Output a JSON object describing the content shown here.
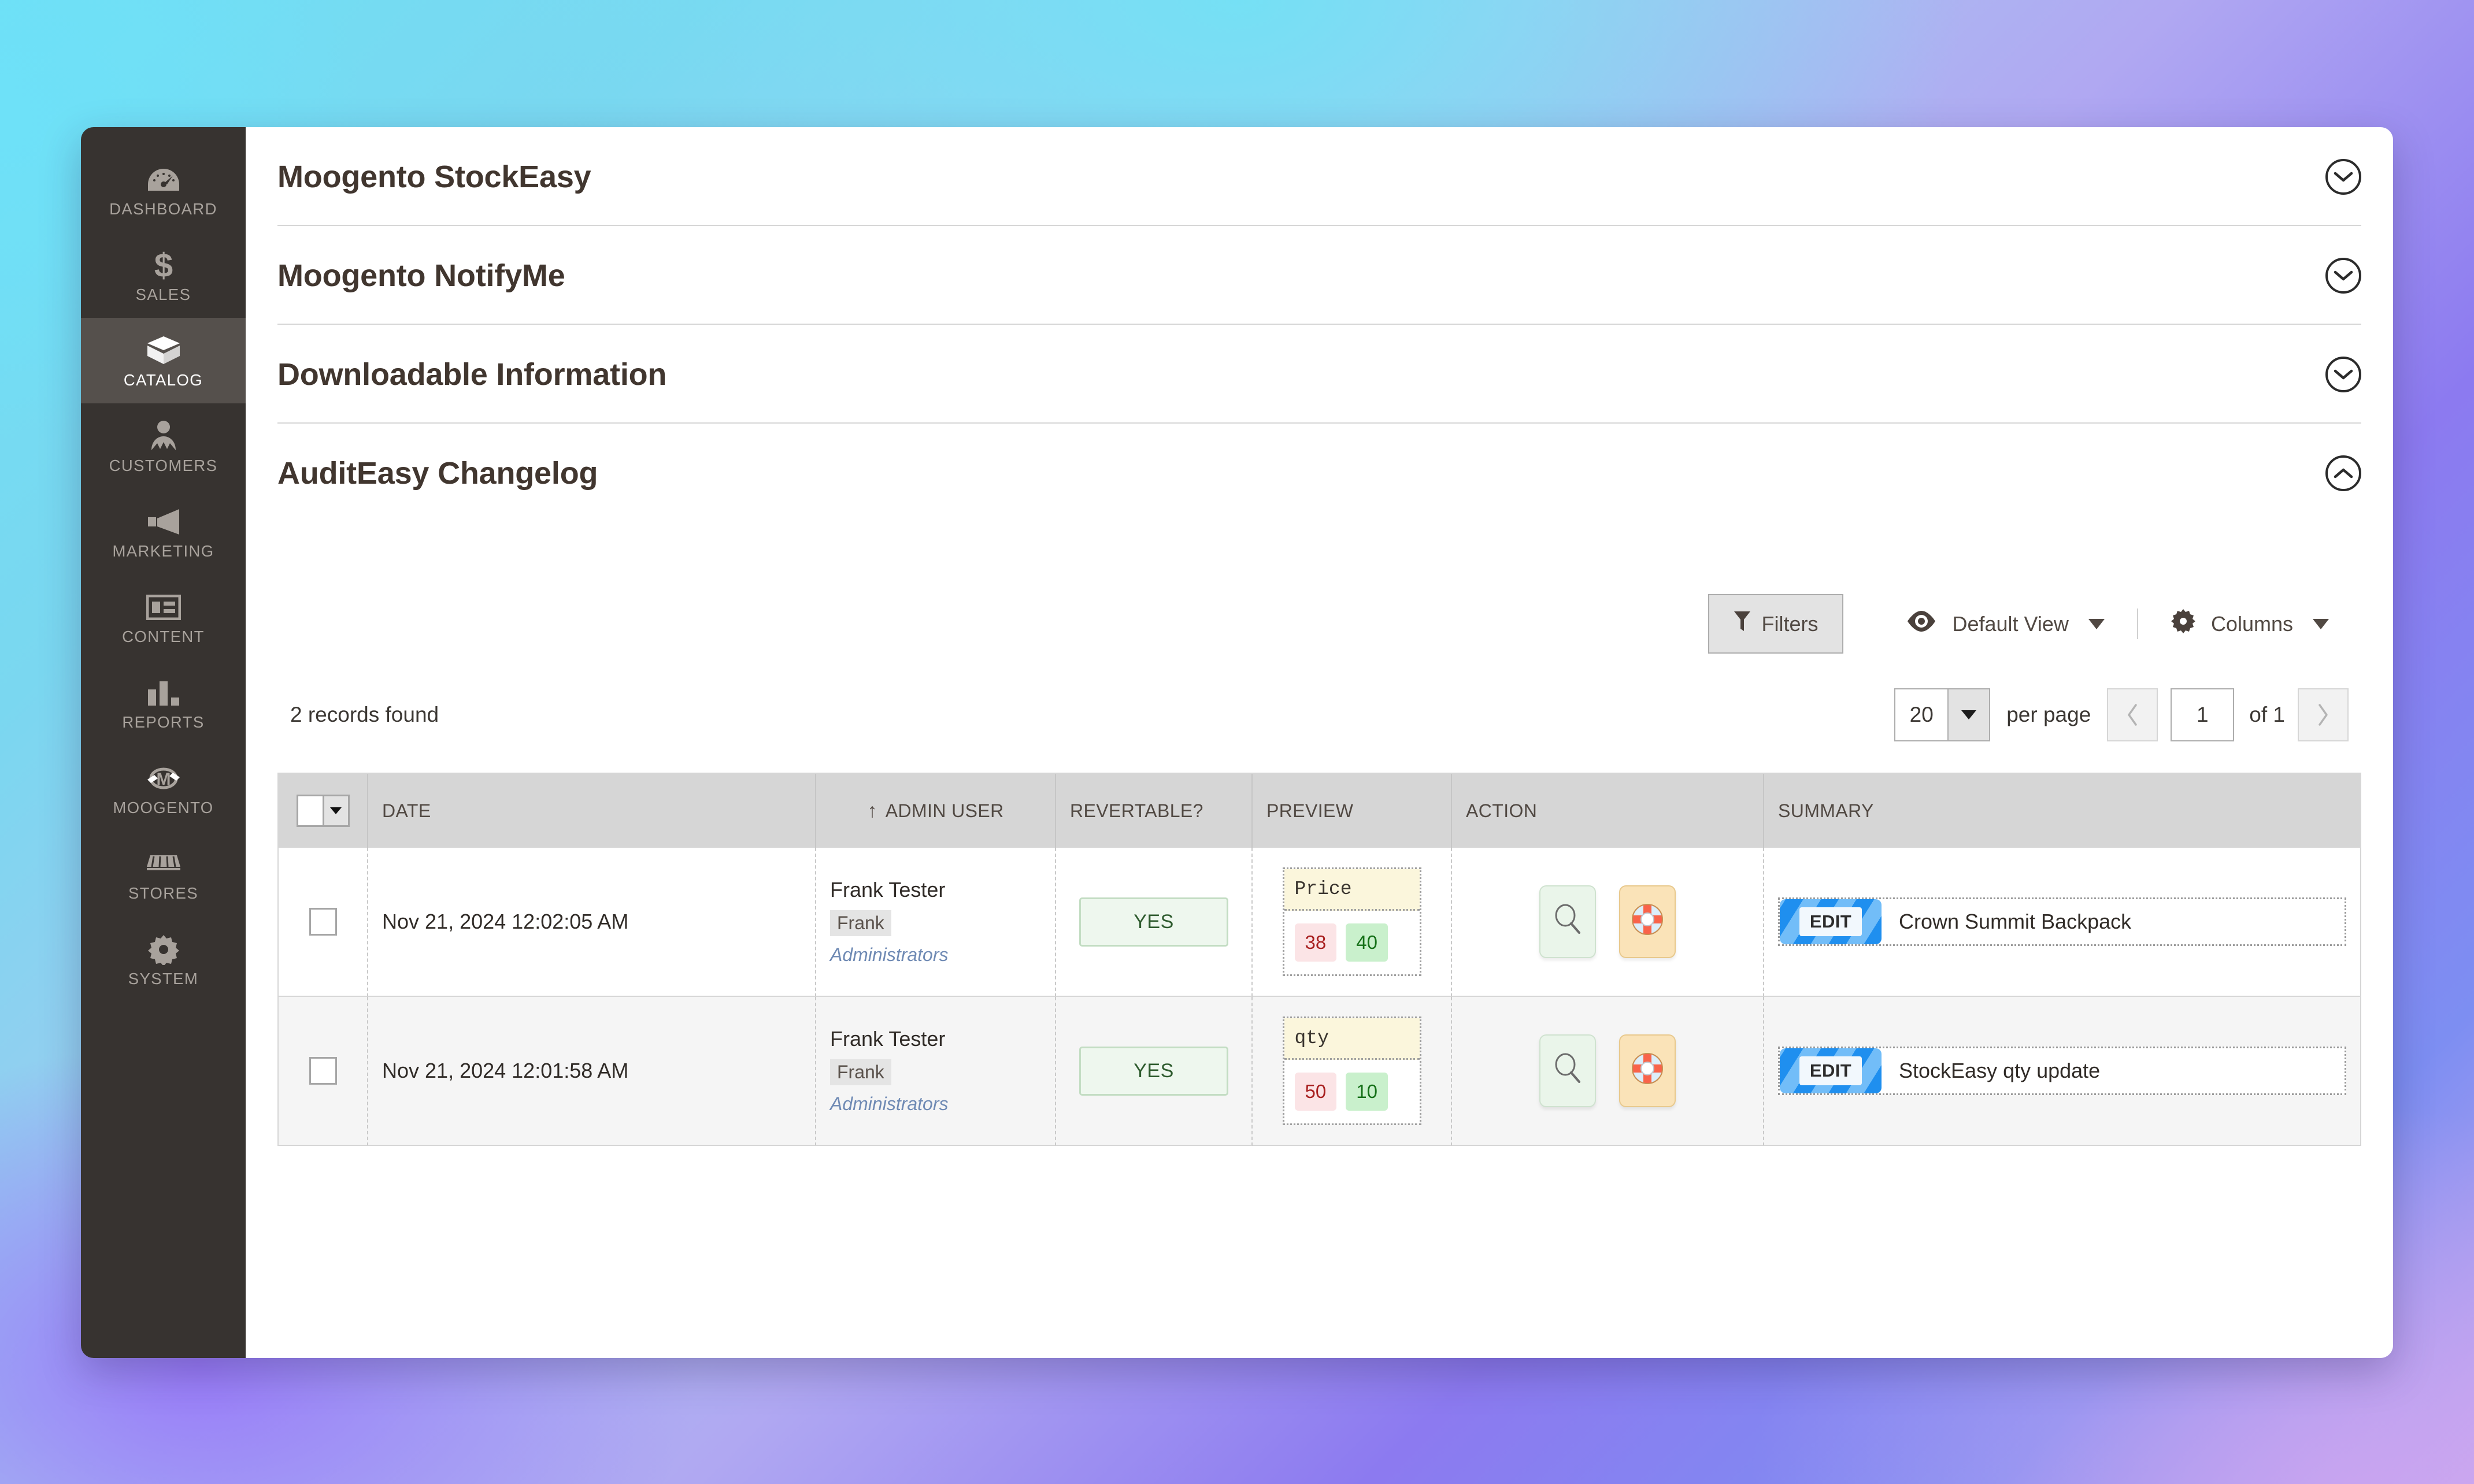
{
  "sidebar": {
    "items": [
      {
        "label": "DASHBOARD",
        "icon": "gauge-icon",
        "active": false
      },
      {
        "label": "SALES",
        "icon": "dollar-icon",
        "active": false
      },
      {
        "label": "CATALOG",
        "icon": "box-icon",
        "active": true
      },
      {
        "label": "CUSTOMERS",
        "icon": "person-icon",
        "active": false
      },
      {
        "label": "MARKETING",
        "icon": "megaphone-icon",
        "active": false
      },
      {
        "label": "CONTENT",
        "icon": "layout-icon",
        "active": false
      },
      {
        "label": "REPORTS",
        "icon": "bar-chart-icon",
        "active": false
      },
      {
        "label": "MOOGENTO",
        "icon": "moogento-m-icon",
        "active": false
      },
      {
        "label": "STORES",
        "icon": "storefront-icon",
        "active": false
      },
      {
        "label": "SYSTEM",
        "icon": "gear-icon",
        "active": false
      }
    ]
  },
  "sections": [
    {
      "title": "Moogento StockEasy",
      "expanded": false,
      "icon": "chevron-down-icon"
    },
    {
      "title": "Moogento NotifyMe",
      "expanded": false,
      "icon": "chevron-down-icon"
    },
    {
      "title": "Downloadable Information",
      "expanded": false,
      "icon": "chevron-down-icon"
    },
    {
      "title": "AuditEasy Changelog",
      "expanded": true,
      "icon": "chevron-up-icon"
    }
  ],
  "toolbar": {
    "filters_label": "Filters",
    "filters_icon": "funnel-icon",
    "view_label": "Default View",
    "view_icon": "eye-icon",
    "columns_label": "Columns",
    "columns_icon": "gear-icon"
  },
  "pager": {
    "records_found": "2 records found",
    "per_page_value": "20",
    "per_page_label": "per page",
    "current_page": "1",
    "of_label": "of 1",
    "prev_icon": "chevron-left-icon",
    "next_icon": "chevron-right-icon"
  },
  "grid": {
    "columns": [
      {
        "key": "check",
        "label": ""
      },
      {
        "key": "date",
        "label": "DATE",
        "sorted": "asc",
        "sort_icon": "arrow-up-icon"
      },
      {
        "key": "admin_user",
        "label": "ADMIN USER"
      },
      {
        "key": "revertable",
        "label": "REVERTABLE?"
      },
      {
        "key": "preview",
        "label": "PREVIEW"
      },
      {
        "key": "action",
        "label": "ACTION"
      },
      {
        "key": "summary",
        "label": "SUMMARY"
      }
    ],
    "rows": [
      {
        "date": "Nov 21, 2024 12:02:05 AM",
        "user_name": "Frank Tester",
        "user_login": "Frank",
        "user_role": "Administrators",
        "revertable": "YES",
        "preview_field": "Price",
        "preview_old": "38",
        "preview_new": "40",
        "action_view_icon": "magnifier-icon",
        "action_revert_icon": "life-preserver-icon",
        "summary_tag": "EDIT",
        "summary_text": "Crown Summit Backpack"
      },
      {
        "date": "Nov 21, 2024 12:01:58 AM",
        "user_name": "Frank Tester",
        "user_login": "Frank",
        "user_role": "Administrators",
        "revertable": "YES",
        "preview_field": "qty",
        "preview_old": "50",
        "preview_new": "10",
        "action_view_icon": "magnifier-icon",
        "action_revert_icon": "life-preserver-icon",
        "summary_tag": "EDIT",
        "summary_text": "StockEasy qty update"
      }
    ]
  },
  "colors": {
    "sidebar_bg": "#373330",
    "sidebar_active": "#55504c",
    "accent_blue": "#1f8fef",
    "ok_green": "#2e5b2e",
    "old_value_red": "#a82020",
    "new_value_green": "#157018"
  }
}
